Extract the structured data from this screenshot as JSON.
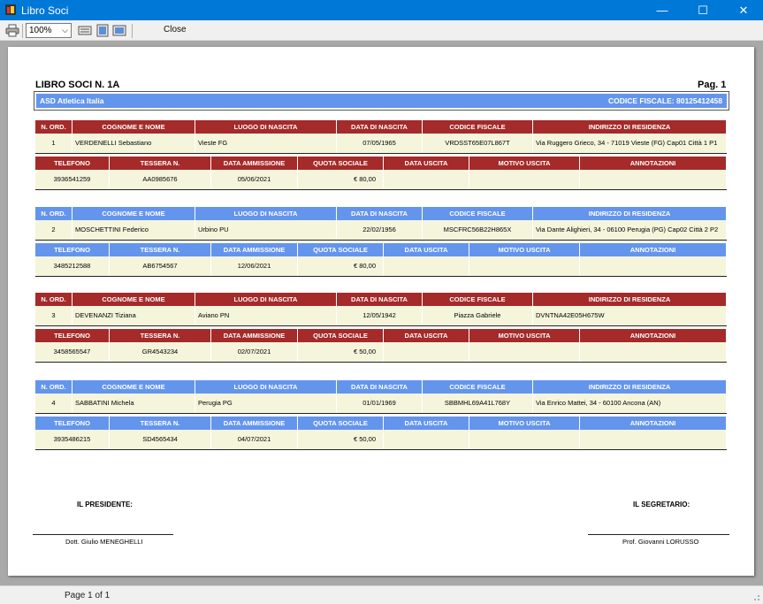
{
  "window": {
    "title": "Libro Soci",
    "minimize": "—",
    "maximize": "☐",
    "close": "✕"
  },
  "toolbar": {
    "zoom": "100%",
    "close_label": "Close"
  },
  "status": {
    "page_info": "Page 1 of 1"
  },
  "report": {
    "title": "LIBRO SOCI N. 1A",
    "page": "Pag. 1",
    "association": "ASD Atletica Italia",
    "fiscal_code": "CODICE FISCALE:  80125412458",
    "headers_1": [
      "N. ORD.",
      "COGNOME E NOME",
      "LUOGO DI NASCITA",
      "DATA DI NASCITA",
      "CODICE FISCALE",
      "INDIRIZZO DI RESIDENZA"
    ],
    "headers_2": [
      "TELEFONO",
      "TESSERA N.",
      "DATA AMMISSIONE",
      "QUOTA SOCIALE",
      "DATA USCITA",
      "MOTIVO USCITA",
      "ANNOTAZIONI"
    ],
    "members": [
      {
        "n": "1",
        "name": "VERDENELLI Sebastiano",
        "birthplace": "Vieste FG",
        "birthdate": "07/05/1965",
        "cf": "VRDSST65E07L867T",
        "address": "Via Ruggero Grieco, 34 - 71019 Vieste (FG) Cap01 Città 1 P1",
        "phone": "3936541259",
        "card": "AA0985676",
        "admission": "05/06/2021",
        "fee": "€ 80,00",
        "exit": "",
        "reason": "",
        "notes": "",
        "color": "red"
      },
      {
        "n": "2",
        "name": "MOSCHETTINI Federico",
        "birthplace": "Urbino PU",
        "birthdate": "22/02/1956",
        "cf": "MSCFRC56B22H865X",
        "address": "Via Dante Alighieri, 34 - 06100 Perugia (PG) Cap02 Città 2 P2",
        "phone": "3485212588",
        "card": "AB6754567",
        "admission": "12/06/2021",
        "fee": "€ 80,00",
        "exit": "",
        "reason": "",
        "notes": "",
        "color": "blue"
      },
      {
        "n": "3",
        "name": "DEVENANZI Tiziana",
        "birthplace": "Aviano PN",
        "birthdate": "12/05/1942",
        "cf": "Piazza Gabriele",
        "address": "DVNTNA42E05H675W",
        "phone": "3458565547",
        "card": "GR4543234",
        "admission": "02/07/2021",
        "fee": "€ 50,00",
        "exit": "",
        "reason": "",
        "notes": "",
        "color": "red"
      },
      {
        "n": "4",
        "name": "SABBATINI Michela",
        "birthplace": "Perugia PG",
        "birthdate": "01/01/1969",
        "cf": "SBBMHL69A41L768Y",
        "address": "Via Enrico Mattei, 34 - 60100 Ancona (AN)",
        "phone": "3935486215",
        "card": "SD4565434",
        "admission": "04/07/2021",
        "fee": "€ 50,00",
        "exit": "",
        "reason": "",
        "notes": "",
        "color": "blue"
      }
    ],
    "president_label": "IL PRESIDENTE:",
    "president_name": "Dott. Giulio MENEGHELLI",
    "secretary_label": "IL SEGRETARIO:",
    "secretary_name": "Prof. Giovanni LORUSSO"
  },
  "colors": {
    "red": "#a52a2a",
    "blue": "#6495ed",
    "row_bg": "#f5f5dc"
  }
}
